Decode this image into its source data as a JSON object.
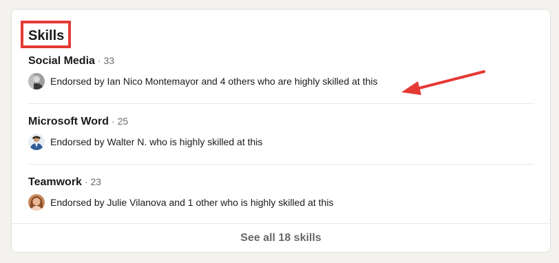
{
  "section": {
    "title": "Skills"
  },
  "skills": [
    {
      "name": "Social Media",
      "count": "· 33",
      "endorsement": "Endorsed by Ian Nico Montemayor and 4 others who are highly skilled at this",
      "avatar_icon": "avatar-icon"
    },
    {
      "name": "Microsoft Word",
      "count": "· 25",
      "endorsement": "Endorsed by Walter N. who is highly skilled at this",
      "avatar_icon": "avatar-icon"
    },
    {
      "name": "Teamwork",
      "count": "· 23",
      "endorsement": "Endorsed by Julie Vilanova and 1 other who is highly skilled at this",
      "avatar_icon": "avatar-icon"
    }
  ],
  "footer": {
    "see_all_label": "See all 18 skills"
  },
  "annotation": {
    "highlight_color": "#e53935",
    "arrow_color": "#e53935"
  }
}
